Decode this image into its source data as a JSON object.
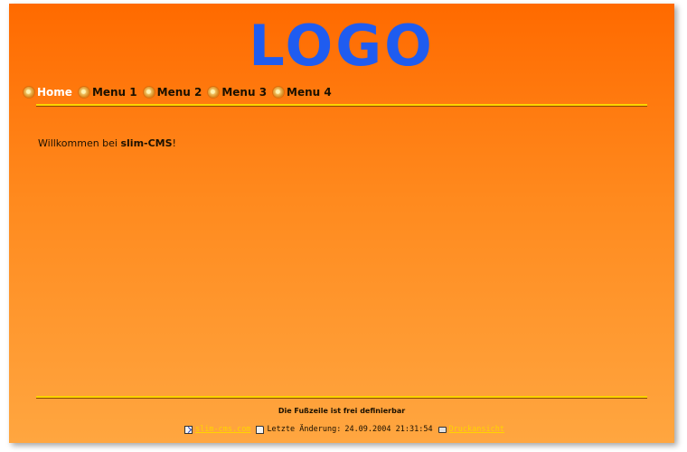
{
  "header": {
    "logo_text": "LOGO"
  },
  "nav": {
    "items": [
      {
        "label": "Home",
        "active": true
      },
      {
        "label": "Menu 1"
      },
      {
        "label": "Menu 2"
      },
      {
        "label": "Menu 3"
      },
      {
        "label": "Menu 4"
      }
    ]
  },
  "content": {
    "welcome_prefix": "Willkommen bei ",
    "welcome_brand": "slim-CMS",
    "welcome_suffix": "!"
  },
  "footer": {
    "text": "Die Fußzeile ist frei definierbar",
    "site_link": "slim-cms.com",
    "last_modified_label": "Letzte Änderung:",
    "last_modified_value": "24.09.2004 21:31:54",
    "print_link": "Druckansicht"
  },
  "colors": {
    "logo": "#1f5cf0",
    "background_top": "#ff6a00",
    "background_bottom": "#ffa640",
    "rule": "#ffd400",
    "link": "#ffd400"
  }
}
